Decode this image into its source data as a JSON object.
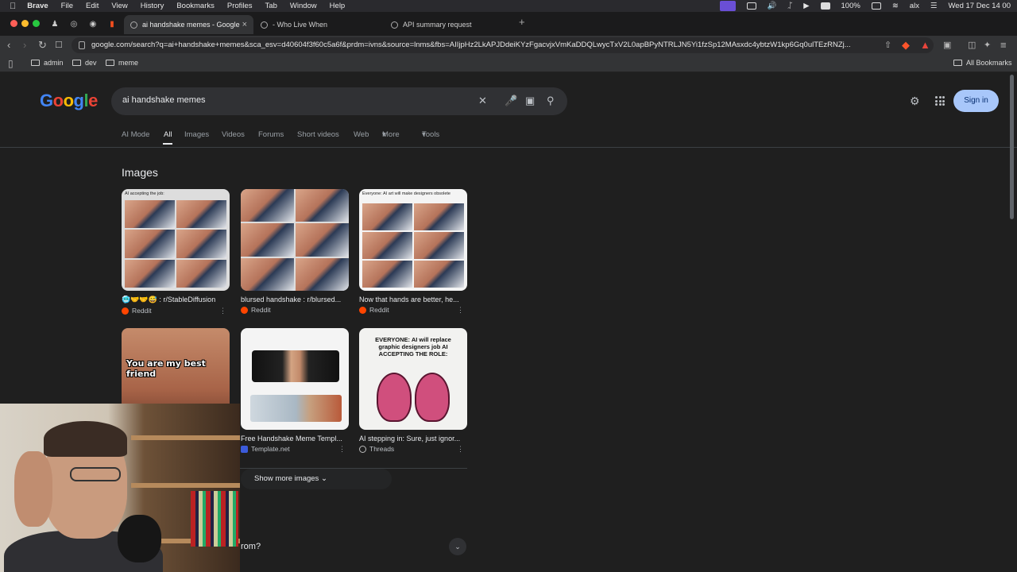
{
  "menubar": {
    "app": "Brave",
    "items": [
      "File",
      "Edit",
      "View",
      "History",
      "Bookmarks",
      "Profiles",
      "Tab",
      "Window",
      "Help"
    ],
    "battery": "100%",
    "user": "alx",
    "datetime": "Wed 17 Dec  14 00"
  },
  "tabs": [
    {
      "title": "ai handshake memes - Google",
      "active": true
    },
    {
      "title": "- Who Live When",
      "active": false
    },
    {
      "title": "API summary request",
      "active": false
    }
  ],
  "toolbar": {
    "url": "google.com/search?q=ai+handshake+memes&sca_esv=d40604f3f60c5a6f&prdm=ivns&source=lnms&fbs=AIIjpHz2LkAPJDdeiKYzFgacvjxVmKaDDQLwycTxV2L0apBPyNTRLJN5Yi1fzSp12MAsxdc4ybtzW1kp6Gq0ulTEzRNZj..."
  },
  "bookmarks": {
    "items": [
      "admin",
      "dev",
      "meme"
    ],
    "all": "All Bookmarks"
  },
  "google": {
    "logo": "Google",
    "query": "ai handshake memes",
    "signin": "Sign in",
    "filters": [
      "AI Mode",
      "All",
      "Images",
      "Videos",
      "Forums",
      "Short videos",
      "Web",
      "More",
      "Tools"
    ],
    "section_title": "Images",
    "images": [
      {
        "caption": "🥶🤝🤝😅 : r/StableDiffusion",
        "source": "Reddit",
        "label": "AI accepting the job:"
      },
      {
        "caption": "blursed handshake : r/blursed...",
        "source": "Reddit",
        "label": ""
      },
      {
        "caption": "Now that hands are better, he...",
        "source": "Reddit",
        "label": "Everyone: AI art will make designers obsolete"
      },
      {
        "caption": "",
        "source": "",
        "label": "You are my best friend"
      },
      {
        "caption": "Free Handshake Meme Templ...",
        "source": "Template.net",
        "label": ""
      },
      {
        "caption": "AI stepping in: Sure, just ignor...",
        "source": "Threads",
        "label": "EVERYONE: AI will replace graphic designers job\nAI ACCEPTING THE ROLE:"
      }
    ],
    "show_more": "Show more images",
    "faq_fragment": "rom?"
  },
  "colors": {
    "accent": "#a8c7fa",
    "background": "#1f1f1f",
    "reddit": "#ff4500"
  }
}
